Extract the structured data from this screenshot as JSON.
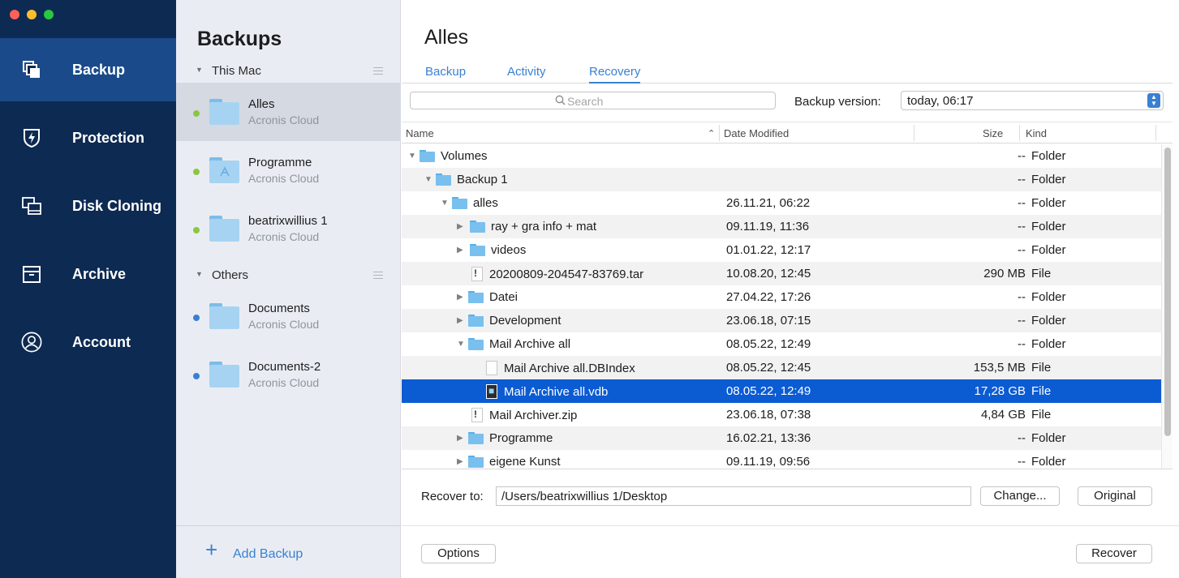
{
  "nav": {
    "items": [
      {
        "label": "Backup",
        "icon": "backup-copies-icon"
      },
      {
        "label": "Protection",
        "icon": "shield-bolt-icon"
      },
      {
        "label": "Disk Cloning",
        "icon": "disk-clone-icon"
      },
      {
        "label": "Archive",
        "icon": "archive-box-icon"
      },
      {
        "label": "Account",
        "icon": "user-circle-icon"
      }
    ]
  },
  "backups": {
    "title": "Backups",
    "group_this_mac": "This Mac",
    "group_others": "Others",
    "items": [
      {
        "name": "Alles",
        "location": "Acronis Cloud"
      },
      {
        "name": "Programme",
        "location": "Acronis Cloud"
      },
      {
        "name": "beatrixwillius 1",
        "location": "Acronis Cloud"
      },
      {
        "name": "Documents",
        "location": "Acronis Cloud"
      },
      {
        "name": "Documents-2",
        "location": "Acronis Cloud"
      }
    ],
    "add_label": "Add Backup"
  },
  "main": {
    "title": "Alles",
    "tabs": [
      {
        "label": "Backup"
      },
      {
        "label": "Activity"
      },
      {
        "label": "Recovery"
      }
    ],
    "search_placeholder": "Search",
    "backup_version_label": "Backup version:",
    "backup_version_value": "today, 06:17",
    "columns": {
      "name": "Name",
      "date": "Date Modified",
      "size": "Size",
      "kind": "Kind"
    },
    "rows": [
      {
        "name": "Volumes",
        "date": "",
        "size": "--",
        "kind": "Folder"
      },
      {
        "name": "Backup 1",
        "date": "",
        "size": "--",
        "kind": "Folder"
      },
      {
        "name": "alles",
        "date": "26.11.21, 06:22",
        "size": "--",
        "kind": "Folder"
      },
      {
        "name": "ray + gra info + mat",
        "date": "09.11.19, 11:36",
        "size": "--",
        "kind": "Folder"
      },
      {
        "name": "videos",
        "date": "01.01.22, 12:17",
        "size": "--",
        "kind": "Folder"
      },
      {
        "name": "20200809-204547-83769.tar",
        "date": "10.08.20, 12:45",
        "size": "290 MB",
        "kind": "File"
      },
      {
        "name": "Datei",
        "date": "27.04.22, 17:26",
        "size": "--",
        "kind": "Folder"
      },
      {
        "name": "Development",
        "date": "23.06.18, 07:15",
        "size": "--",
        "kind": "Folder"
      },
      {
        "name": "Mail Archive all",
        "date": "08.05.22, 12:49",
        "size": "--",
        "kind": "Folder"
      },
      {
        "name": "Mail Archive all.DBIndex",
        "date": "08.05.22, 12:45",
        "size": "153,5 MB",
        "kind": "File"
      },
      {
        "name": "Mail Archive all.vdb",
        "date": "08.05.22, 12:49",
        "size": "17,28 GB",
        "kind": "File"
      },
      {
        "name": "Mail Archiver.zip",
        "date": "23.06.18, 07:38",
        "size": "4,84 GB",
        "kind": "File"
      },
      {
        "name": "Programme",
        "date": "16.02.21, 13:36",
        "size": "--",
        "kind": "Folder"
      },
      {
        "name": "eigene Kunst",
        "date": "09.11.19, 09:56",
        "size": "--",
        "kind": "Folder"
      }
    ],
    "recover_to_label": "Recover to:",
    "recover_to_path": "/Users/beatrixwillius 1/Desktop",
    "change_label": "Change...",
    "original_label": "Original",
    "options_label": "Options",
    "recover_label": "Recover"
  },
  "colors": {
    "nav_bg": "#0d2a52",
    "nav_active": "#1a4a8a",
    "accent": "#3a80d2",
    "selection": "#0b5bd3",
    "dot_green": "#8cc63f",
    "dot_blue": "#3a80d2"
  }
}
